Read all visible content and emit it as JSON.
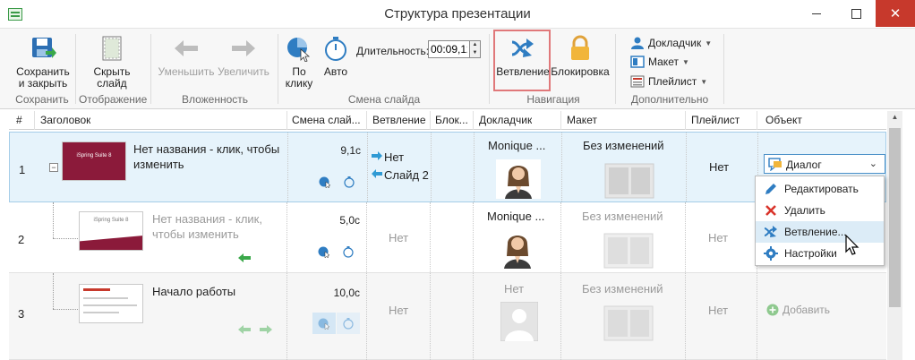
{
  "window": {
    "title": "Структура презентации"
  },
  "ribbon": {
    "save_close": "Сохранить\nи закрыть",
    "hide_slide": "Скрыть\nслайд",
    "decrease": "Уменьшить",
    "increase": "Увеличить",
    "on_click": "По\nклику",
    "auto": "Авто",
    "duration_label": "Длительность:",
    "duration_value": "00:09,12",
    "branching": "Ветвление",
    "lock": "Блокировка",
    "narrator": "Докладчик",
    "layout": "Макет",
    "playlist": "Плейлист",
    "groups": {
      "save": "Сохранить",
      "display": "Отображение",
      "nesting": "Вложенность",
      "slide_change": "Смена слайда",
      "navigation": "Навигация",
      "extra": "Дополнительно"
    }
  },
  "table": {
    "headers": {
      "num": "#",
      "title": "Заголовок",
      "change": "Смена слай...",
      "branch": "Ветвление",
      "lock": "Блок...",
      "narrator": "Докладчик",
      "layout": "Макет",
      "playlist": "Плейлист",
      "object": "Объект"
    },
    "rows": [
      {
        "num": "1",
        "title": "Нет названия - клик, чтобы изменить",
        "duration": "9,1с",
        "branch_next": "Нет",
        "branch_prev": "Слайд 2",
        "narrator": "Monique ...",
        "layout": "Без изменений",
        "playlist": "Нет",
        "object": "Диалог",
        "thumb_brand": "iSpring Suite 8"
      },
      {
        "num": "2",
        "title": "Нет названия - клик, чтобы изменить",
        "duration": "5,0с",
        "branch": "Нет",
        "narrator": "Monique ...",
        "layout": "Без изменений",
        "playlist": "Нет",
        "thumb_brand": "iSpring Suite 8"
      },
      {
        "num": "3",
        "title": "Начало работы",
        "duration": "10,0с",
        "branch": "Нет",
        "narrator": "Нет",
        "layout": "Без изменений",
        "playlist": "Нет",
        "object_add": "Добавить"
      }
    ]
  },
  "context_menu": {
    "items": [
      "Редактировать",
      "Удалить",
      "Ветвление...",
      "Настройки"
    ]
  },
  "colors": {
    "accent": "#2f7dc2",
    "close": "#c7392c",
    "slide": "#8b1a3a",
    "green": "#3aa84a"
  }
}
